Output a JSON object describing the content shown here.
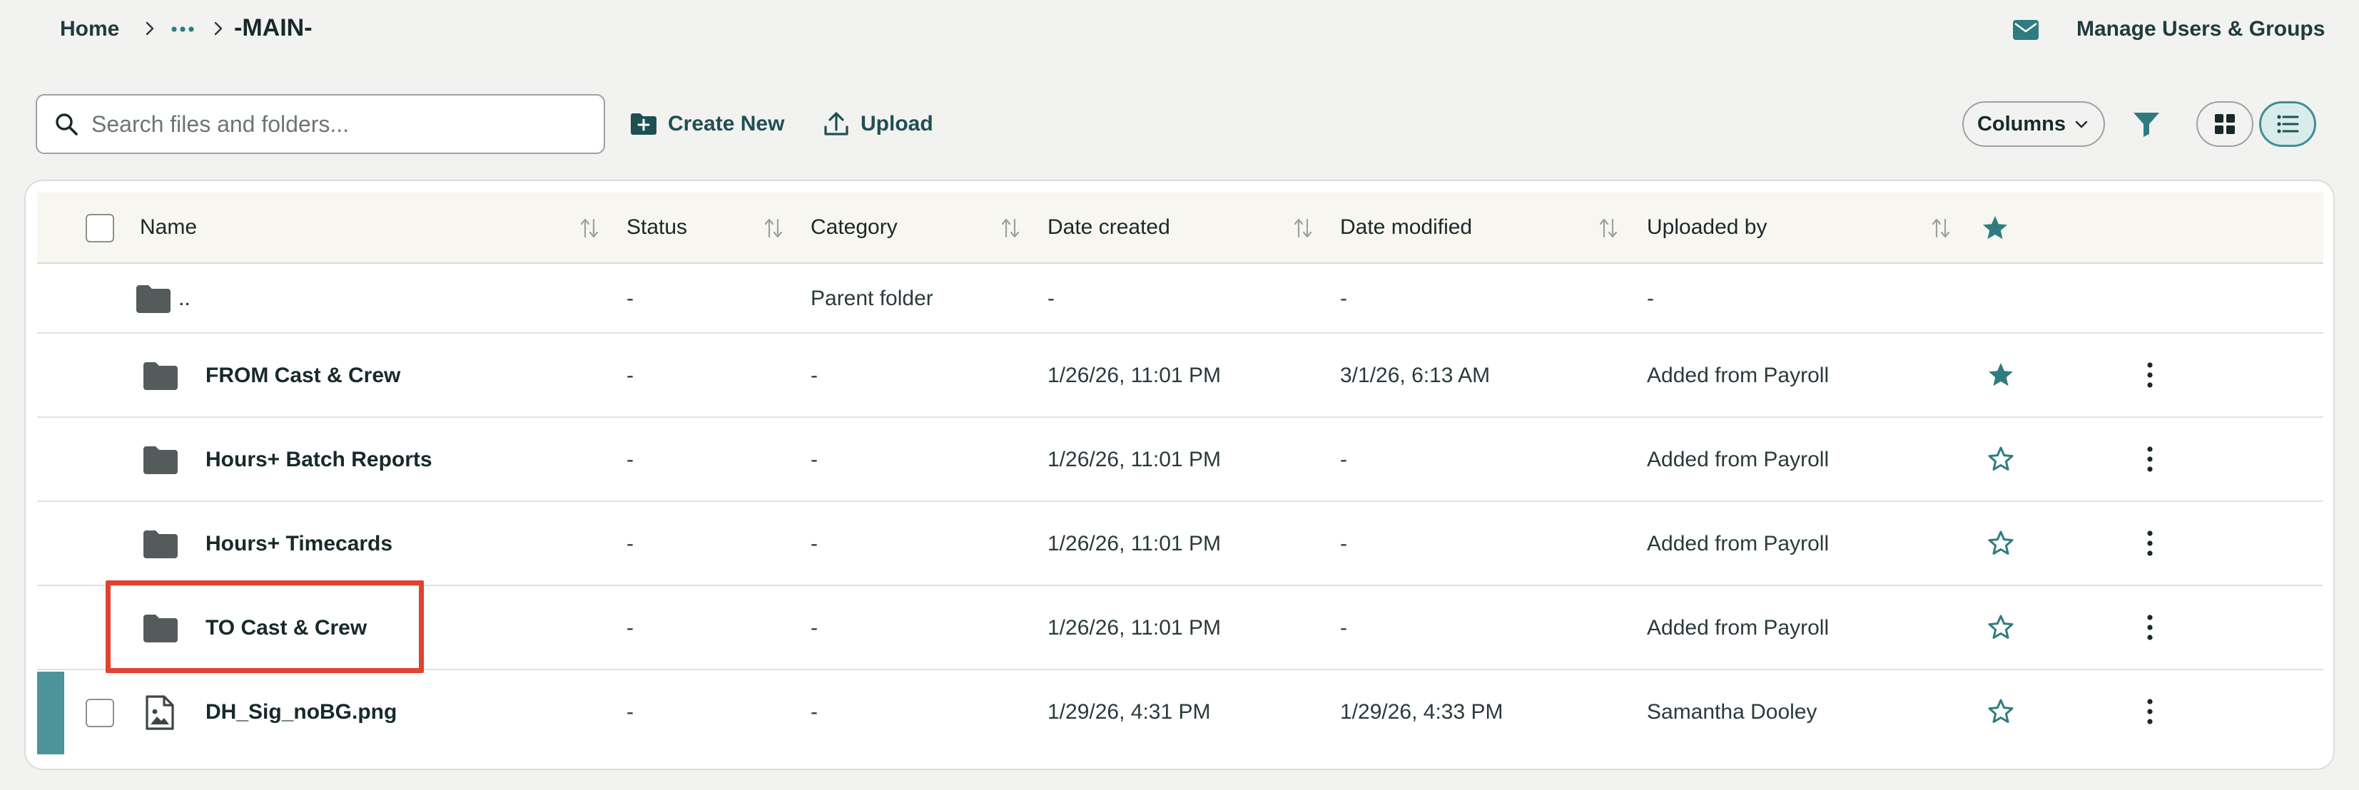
{
  "breadcrumb": {
    "home": "Home",
    "current": "-MAIN-"
  },
  "header": {
    "manage_label": "Manage Users & Groups"
  },
  "toolbar": {
    "search_placeholder": "Search files and folders...",
    "create_label": "Create New",
    "upload_label": "Upload",
    "columns_label": "Columns"
  },
  "table": {
    "columns": [
      "Name",
      "Status",
      "Category",
      "Date created",
      "Date modified",
      "Uploaded by"
    ],
    "parent": {
      "name": "..",
      "status": "-",
      "category": "Parent folder",
      "created": "-",
      "modified": "-",
      "uploaded_by": "-"
    },
    "rows": [
      {
        "name": "FROM Cast & Crew",
        "type": "folder",
        "status": "-",
        "category": "-",
        "created": "1/26/26, 11:01 PM",
        "modified": "3/1/26, 6:13 AM",
        "uploaded_by": "Added from Payroll",
        "starred": true
      },
      {
        "name": "Hours+ Batch Reports",
        "type": "folder",
        "status": "-",
        "category": "-",
        "created": "1/26/26, 11:01 PM",
        "modified": "-",
        "uploaded_by": "Added from Payroll",
        "starred": false
      },
      {
        "name": "Hours+ Timecards",
        "type": "folder",
        "status": "-",
        "category": "-",
        "created": "1/26/26, 11:01 PM",
        "modified": "-",
        "uploaded_by": "Added from Payroll",
        "starred": false
      },
      {
        "name": "TO Cast & Crew",
        "type": "folder",
        "status": "-",
        "category": "-",
        "created": "1/26/26, 11:01 PM",
        "modified": "-",
        "uploaded_by": "Added from Payroll",
        "starred": false
      },
      {
        "name": "DH_Sig_noBG.png",
        "type": "image-file",
        "status": "-",
        "category": "-",
        "created": "1/29/26, 4:31 PM",
        "modified": "1/29/26, 4:33 PM",
        "uploaded_by": "Samantha Dooley",
        "starred": false
      }
    ]
  },
  "colors": {
    "accent": "#4d9399",
    "brand_dark": "#1f4f52",
    "highlight": "#e0432f",
    "star": "#2f7c80"
  },
  "icons": {
    "chevron": "chevron-right-icon",
    "more": "more-horizontal-icon",
    "mail": "mail-icon",
    "search": "search-icon",
    "create": "folder-plus-icon",
    "upload": "upload-icon",
    "filter": "filter-icon",
    "grid": "grid-view-icon",
    "list": "list-view-icon",
    "sort": "sort-icon",
    "star": "star-icon",
    "menu": "kebab-menu-icon",
    "folder": "folder-icon",
    "file": "image-file-icon"
  }
}
